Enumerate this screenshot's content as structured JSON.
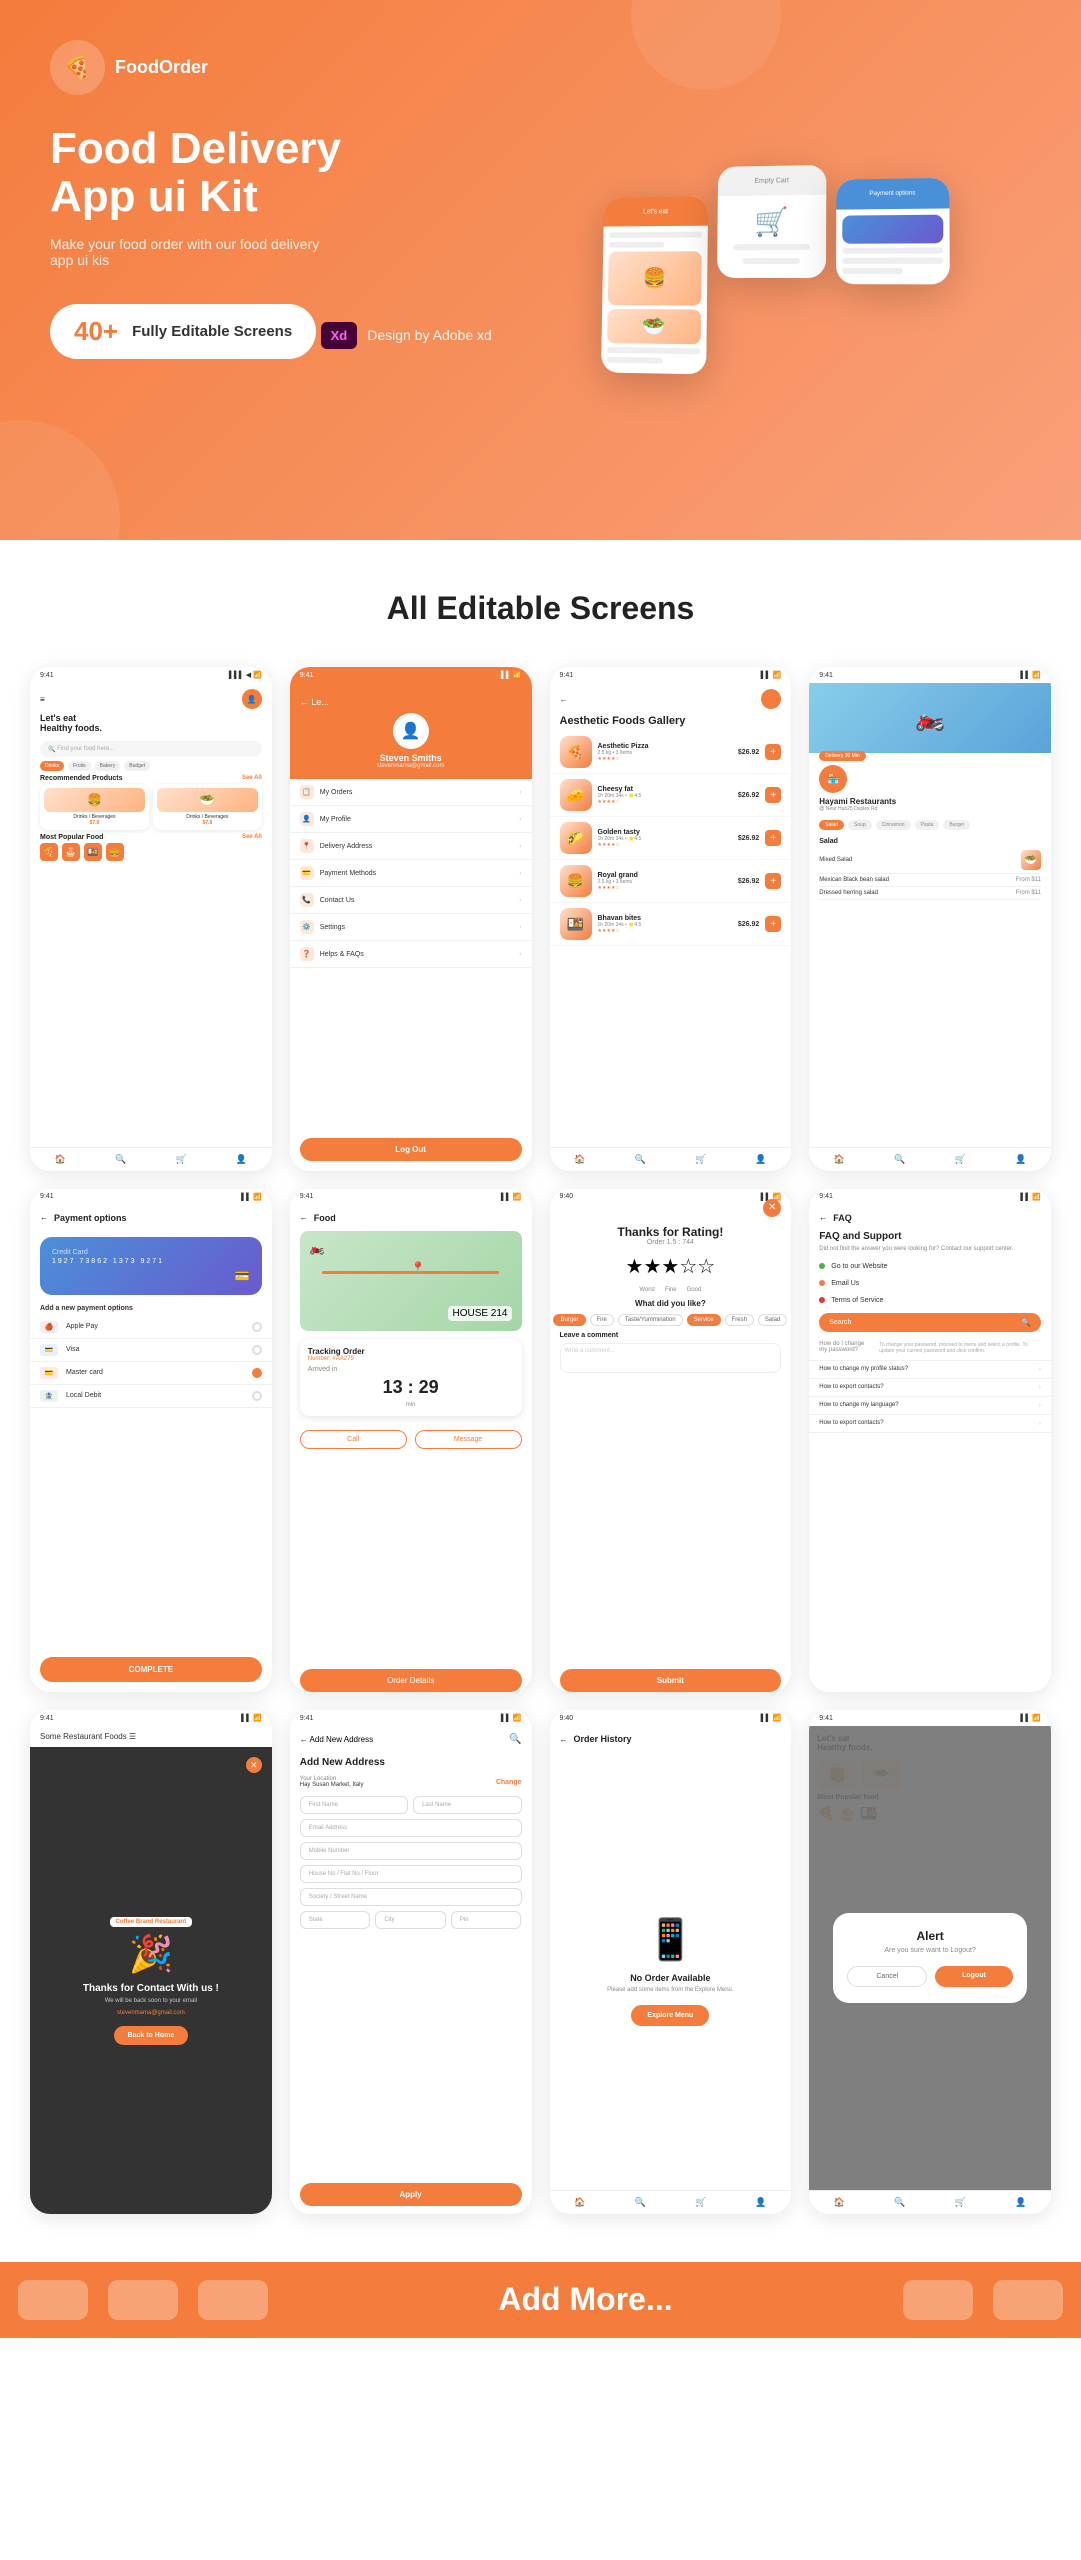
{
  "hero": {
    "logo_icon": "🍕",
    "logo_text": "FoodOrder",
    "title": "Food Delivery App ui Kit",
    "subtitle": "Make your food order with our food delivery app ui kis",
    "badge_num": "40+",
    "badge_text": "Fully Editable Screens",
    "design_label": "Design by Adobe xd"
  },
  "all_screens": {
    "section_title": "All Editable Screens"
  },
  "screen1": {
    "greeting": "Let's eat",
    "subgreeting": "Healthy foods.",
    "search_placeholder": "Find your food here...",
    "cats": [
      "Drinks",
      "Fruits",
      "Bakery",
      "Budget"
    ],
    "recommended_title": "Recommended Products",
    "see_all": "See All",
    "items": [
      {
        "name": "Drinks / Beverages",
        "emoji": "🍔",
        "price": "$7.8"
      },
      {
        "name": "Drinks / Beverages",
        "emoji": "🥗",
        "price": "$7.8"
      }
    ],
    "popular_title": "Most Popular Food",
    "popular_items": [
      {
        "name": "Pizza",
        "emoji": "🍕"
      },
      {
        "name": "Cakes",
        "emoji": "🎂"
      },
      {
        "name": "Meals",
        "emoji": "🍱"
      },
      {
        "name": "Burg",
        "emoji": "🍔"
      }
    ]
  },
  "screen2": {
    "name": "Steven Smiths",
    "email": "stevenmama@gmail.com",
    "menu": [
      {
        "icon": "📋",
        "label": "My Orders"
      },
      {
        "icon": "👤",
        "label": "My Profile"
      },
      {
        "icon": "📍",
        "label": "Delivery Address"
      },
      {
        "icon": "💳",
        "label": "Payment Methods"
      },
      {
        "icon": "📞",
        "label": "Contact Us"
      },
      {
        "icon": "⚙️",
        "label": "Settings"
      },
      {
        "icon": "❓",
        "label": "Helps & FAQs"
      }
    ],
    "logout": "Log Out"
  },
  "screen3": {
    "title": "Aesthetic Foods Gallery",
    "items": [
      {
        "name": "Aesthetic Pizza",
        "meta": "2.5 kg • 3 Items",
        "stars": "★★★★",
        "price": "$26.92",
        "emoji": "🍕"
      },
      {
        "name": "Cheesy fat",
        "meta": "1h 20m 34s • ⭐4.5",
        "stars": "★★★★",
        "price": "$26.92",
        "emoji": "🧀"
      },
      {
        "name": "Golden tasty",
        "meta": "1h 20m 34s • ⭐4.5",
        "stars": "★★★★",
        "price": "$26.92",
        "emoji": "🌮"
      },
      {
        "name": "Royal grand",
        "meta": "2.5 kg • 3 Items",
        "stars": "★★★★",
        "price": "$26.92",
        "emoji": "🍔"
      },
      {
        "name": "Bhavan bites",
        "meta": "1h 20m 34s • ⭐4.5",
        "stars": "★★★★",
        "price": "$26.92",
        "emoji": "🍱"
      }
    ]
  },
  "screen4": {
    "restaurant_name": "Hayami Restaurants",
    "restaurant_addr": "@ Near Hub25 Duplex Rd",
    "delivery_badge": "Delivery 30 Min",
    "tabs": [
      "Salad",
      "Soup",
      "Ginnamon",
      "Pasta",
      "Burger"
    ],
    "section": "Salad",
    "items": [
      {
        "name": "Mixed Salad",
        "price": ""
      },
      {
        "name": "Mexican Black bean salad",
        "price": "From $11"
      },
      {
        "name": "Dressed herring salad",
        "price": "From $11"
      }
    ]
  },
  "screen5": {
    "title": "Payment options",
    "card_num": "1927 73862 1373 9271",
    "add_title": "Add a new payment options",
    "options": [
      {
        "name": "Apple Pay",
        "icon": "🍎",
        "color": "#f0f0f0"
      },
      {
        "name": "Visa",
        "icon": "💳",
        "color": "#e8f0fe"
      },
      {
        "name": "Master card",
        "icon": "💳",
        "color": "#ffe8e8"
      },
      {
        "name": "Local Debit",
        "icon": "🏦",
        "color": "#e8f5e9"
      }
    ],
    "complete": "COMPLETE"
  },
  "screen6": {
    "title": "Food",
    "track_title": "Tracking Order",
    "track_id": "Number: #AA279",
    "arrived_label": "Arrived in",
    "time": "13 : 29",
    "time_unit": "min",
    "action1": "Call",
    "action2": "Message",
    "detail_btn": "Order Details"
  },
  "screen7": {
    "title": "Thanks for Rating!",
    "subtitle": "Order 1.5 : 744",
    "stars": "★★★☆☆",
    "like_title": "What did you like?",
    "tags": [
      "Burger",
      "Fire",
      "Taste/Yummination",
      "Service",
      "Fresh",
      "Salad"
    ],
    "comment_title": "Leave a comment",
    "comment_placeholder": "Write a comment...",
    "submit": "Submit"
  },
  "screen8": {
    "title": "FAQ",
    "main_title": "FAQ and Support",
    "desc": "Did not find the answer you were looking for? Contact our support center.",
    "links": [
      {
        "label": "Go to our Website",
        "color": "#4caf50"
      },
      {
        "label": "Email Us",
        "color": "#f47c3c"
      },
      {
        "label": "Terms of Service",
        "color": "#e53935"
      }
    ],
    "search_placeholder": "Search",
    "faqs": [
      "How do I change my password?",
      "How to change my profile status?",
      "How to export contacts?",
      "How to change my language?",
      "How to export contacts?"
    ]
  },
  "screen9": {
    "title": "Thanks for Contact With us !",
    "text": "We will be back soon to your email",
    "email": "stevenmama@gmail.com",
    "btn": "Back to Home"
  },
  "screen10": {
    "title": "Add New Address",
    "loc_label": "Your Location",
    "loc_addr": "Hay Susan Market, Italy",
    "loc_change": "Change",
    "fields": [
      "First Name",
      "Last Name",
      "Email Address",
      "Mobile Number",
      "House No / Flat No / Floor",
      "Society / Street Name"
    ],
    "submit": "Apply"
  },
  "screen11": {
    "title": "Order History",
    "empty_title": "No Order Available",
    "empty_text": "Please add some items from the Explore Menu.",
    "btn": "Explore Menu"
  },
  "screen12": {
    "alert_title": "Alert",
    "alert_text": "Are you sure want to Logout?",
    "cancel": "Cancel",
    "logout": "Logout"
  },
  "bottom": {
    "add_more": "Add More..."
  },
  "colors": {
    "primary": "#f47c3c",
    "white": "#ffffff",
    "dark": "#222222",
    "gray": "#888888"
  }
}
